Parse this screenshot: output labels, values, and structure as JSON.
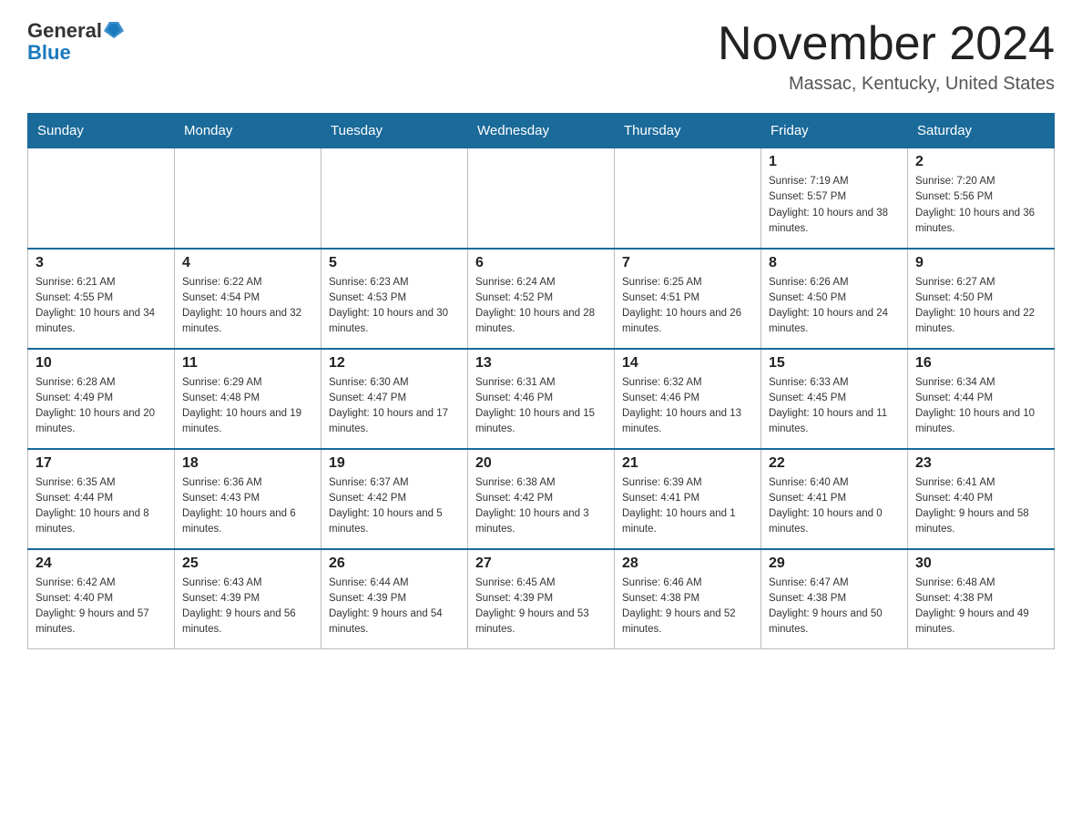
{
  "header": {
    "logo_general": "General",
    "logo_blue": "Blue",
    "month_title": "November 2024",
    "location": "Massac, Kentucky, United States"
  },
  "days_of_week": [
    "Sunday",
    "Monday",
    "Tuesday",
    "Wednesday",
    "Thursday",
    "Friday",
    "Saturday"
  ],
  "weeks": [
    [
      {
        "day": "",
        "sunrise": "",
        "sunset": "",
        "daylight": ""
      },
      {
        "day": "",
        "sunrise": "",
        "sunset": "",
        "daylight": ""
      },
      {
        "day": "",
        "sunrise": "",
        "sunset": "",
        "daylight": ""
      },
      {
        "day": "",
        "sunrise": "",
        "sunset": "",
        "daylight": ""
      },
      {
        "day": "",
        "sunrise": "",
        "sunset": "",
        "daylight": ""
      },
      {
        "day": "1",
        "sunrise": "Sunrise: 7:19 AM",
        "sunset": "Sunset: 5:57 PM",
        "daylight": "Daylight: 10 hours and 38 minutes."
      },
      {
        "day": "2",
        "sunrise": "Sunrise: 7:20 AM",
        "sunset": "Sunset: 5:56 PM",
        "daylight": "Daylight: 10 hours and 36 minutes."
      }
    ],
    [
      {
        "day": "3",
        "sunrise": "Sunrise: 6:21 AM",
        "sunset": "Sunset: 4:55 PM",
        "daylight": "Daylight: 10 hours and 34 minutes."
      },
      {
        "day": "4",
        "sunrise": "Sunrise: 6:22 AM",
        "sunset": "Sunset: 4:54 PM",
        "daylight": "Daylight: 10 hours and 32 minutes."
      },
      {
        "day": "5",
        "sunrise": "Sunrise: 6:23 AM",
        "sunset": "Sunset: 4:53 PM",
        "daylight": "Daylight: 10 hours and 30 minutes."
      },
      {
        "day": "6",
        "sunrise": "Sunrise: 6:24 AM",
        "sunset": "Sunset: 4:52 PM",
        "daylight": "Daylight: 10 hours and 28 minutes."
      },
      {
        "day": "7",
        "sunrise": "Sunrise: 6:25 AM",
        "sunset": "Sunset: 4:51 PM",
        "daylight": "Daylight: 10 hours and 26 minutes."
      },
      {
        "day": "8",
        "sunrise": "Sunrise: 6:26 AM",
        "sunset": "Sunset: 4:50 PM",
        "daylight": "Daylight: 10 hours and 24 minutes."
      },
      {
        "day": "9",
        "sunrise": "Sunrise: 6:27 AM",
        "sunset": "Sunset: 4:50 PM",
        "daylight": "Daylight: 10 hours and 22 minutes."
      }
    ],
    [
      {
        "day": "10",
        "sunrise": "Sunrise: 6:28 AM",
        "sunset": "Sunset: 4:49 PM",
        "daylight": "Daylight: 10 hours and 20 minutes."
      },
      {
        "day": "11",
        "sunrise": "Sunrise: 6:29 AM",
        "sunset": "Sunset: 4:48 PM",
        "daylight": "Daylight: 10 hours and 19 minutes."
      },
      {
        "day": "12",
        "sunrise": "Sunrise: 6:30 AM",
        "sunset": "Sunset: 4:47 PM",
        "daylight": "Daylight: 10 hours and 17 minutes."
      },
      {
        "day": "13",
        "sunrise": "Sunrise: 6:31 AM",
        "sunset": "Sunset: 4:46 PM",
        "daylight": "Daylight: 10 hours and 15 minutes."
      },
      {
        "day": "14",
        "sunrise": "Sunrise: 6:32 AM",
        "sunset": "Sunset: 4:46 PM",
        "daylight": "Daylight: 10 hours and 13 minutes."
      },
      {
        "day": "15",
        "sunrise": "Sunrise: 6:33 AM",
        "sunset": "Sunset: 4:45 PM",
        "daylight": "Daylight: 10 hours and 11 minutes."
      },
      {
        "day": "16",
        "sunrise": "Sunrise: 6:34 AM",
        "sunset": "Sunset: 4:44 PM",
        "daylight": "Daylight: 10 hours and 10 minutes."
      }
    ],
    [
      {
        "day": "17",
        "sunrise": "Sunrise: 6:35 AM",
        "sunset": "Sunset: 4:44 PM",
        "daylight": "Daylight: 10 hours and 8 minutes."
      },
      {
        "day": "18",
        "sunrise": "Sunrise: 6:36 AM",
        "sunset": "Sunset: 4:43 PM",
        "daylight": "Daylight: 10 hours and 6 minutes."
      },
      {
        "day": "19",
        "sunrise": "Sunrise: 6:37 AM",
        "sunset": "Sunset: 4:42 PM",
        "daylight": "Daylight: 10 hours and 5 minutes."
      },
      {
        "day": "20",
        "sunrise": "Sunrise: 6:38 AM",
        "sunset": "Sunset: 4:42 PM",
        "daylight": "Daylight: 10 hours and 3 minutes."
      },
      {
        "day": "21",
        "sunrise": "Sunrise: 6:39 AM",
        "sunset": "Sunset: 4:41 PM",
        "daylight": "Daylight: 10 hours and 1 minute."
      },
      {
        "day": "22",
        "sunrise": "Sunrise: 6:40 AM",
        "sunset": "Sunset: 4:41 PM",
        "daylight": "Daylight: 10 hours and 0 minutes."
      },
      {
        "day": "23",
        "sunrise": "Sunrise: 6:41 AM",
        "sunset": "Sunset: 4:40 PM",
        "daylight": "Daylight: 9 hours and 58 minutes."
      }
    ],
    [
      {
        "day": "24",
        "sunrise": "Sunrise: 6:42 AM",
        "sunset": "Sunset: 4:40 PM",
        "daylight": "Daylight: 9 hours and 57 minutes."
      },
      {
        "day": "25",
        "sunrise": "Sunrise: 6:43 AM",
        "sunset": "Sunset: 4:39 PM",
        "daylight": "Daylight: 9 hours and 56 minutes."
      },
      {
        "day": "26",
        "sunrise": "Sunrise: 6:44 AM",
        "sunset": "Sunset: 4:39 PM",
        "daylight": "Daylight: 9 hours and 54 minutes."
      },
      {
        "day": "27",
        "sunrise": "Sunrise: 6:45 AM",
        "sunset": "Sunset: 4:39 PM",
        "daylight": "Daylight: 9 hours and 53 minutes."
      },
      {
        "day": "28",
        "sunrise": "Sunrise: 6:46 AM",
        "sunset": "Sunset: 4:38 PM",
        "daylight": "Daylight: 9 hours and 52 minutes."
      },
      {
        "day": "29",
        "sunrise": "Sunrise: 6:47 AM",
        "sunset": "Sunset: 4:38 PM",
        "daylight": "Daylight: 9 hours and 50 minutes."
      },
      {
        "day": "30",
        "sunrise": "Sunrise: 6:48 AM",
        "sunset": "Sunset: 4:38 PM",
        "daylight": "Daylight: 9 hours and 49 minutes."
      }
    ]
  ]
}
